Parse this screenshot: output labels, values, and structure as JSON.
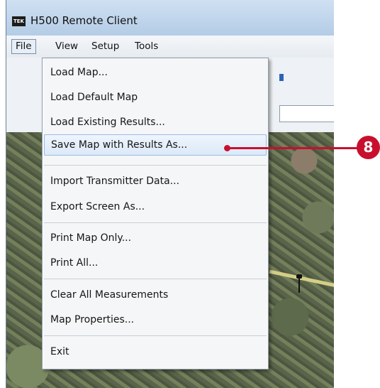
{
  "window": {
    "title": "H500 Remote Client",
    "icon": "app-logo-icon"
  },
  "menubar": {
    "items": [
      "File",
      "View",
      "Setup",
      "Tools"
    ],
    "open_item": "File"
  },
  "file_menu": {
    "items": [
      {
        "label": "Load Map..."
      },
      {
        "label": "Load Default Map"
      },
      {
        "label": "Load Existing Results..."
      },
      {
        "label": "Save Map with Results As...",
        "highlighted": true
      },
      {
        "label": "Import Transmitter Data..."
      },
      {
        "label": "Export Screen As..."
      },
      {
        "label": "Print Map Only..."
      },
      {
        "label": "Print All..."
      },
      {
        "label": "Clear All Measurements"
      },
      {
        "label": "Map Properties..."
      },
      {
        "label": "Exit"
      }
    ]
  },
  "callout": {
    "number": "8",
    "color": "#c8102e"
  },
  "colors": {
    "highlight": "#dce9f8",
    "menu_bg": "#f5f6f8",
    "accent": "#c8102e"
  }
}
